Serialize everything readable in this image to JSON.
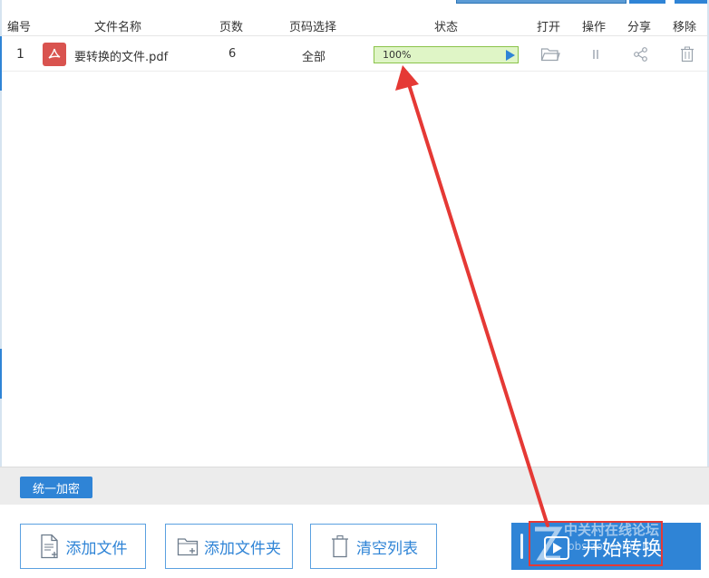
{
  "columns": {
    "index": "编号",
    "filename": "文件名称",
    "pages": "页数",
    "page_select": "页码选择",
    "status": "状态",
    "open": "打开",
    "operate": "操作",
    "share": "分享",
    "remove": "移除"
  },
  "file_row": {
    "index": "1",
    "filename": "要转换的文件.pdf",
    "pages": "6",
    "page_range": "全部",
    "progress_text": "100%",
    "progress": 1.0
  },
  "footer": {
    "encrypt_label": "统一加密"
  },
  "actions": {
    "add_file": "添加文件",
    "add_folder": "添加文件夹",
    "clear_list": "清空列表",
    "start_convert": "开始转换"
  },
  "watermark": {
    "line1": "中关村在线论坛",
    "line2": "bbs.zol.com.cn"
  },
  "colors": {
    "accent": "#2f84d6",
    "pdf_red": "#d9534f",
    "progress_fill": "#dff5c6",
    "progress_border": "#8bc34a",
    "annotation_red": "#e53935"
  },
  "icons": {
    "file": "pdf-file-icon",
    "open": "folder-open-icon",
    "operate": "pause-icon",
    "share": "share-icon",
    "remove": "trash-icon",
    "play": "play-icon"
  }
}
